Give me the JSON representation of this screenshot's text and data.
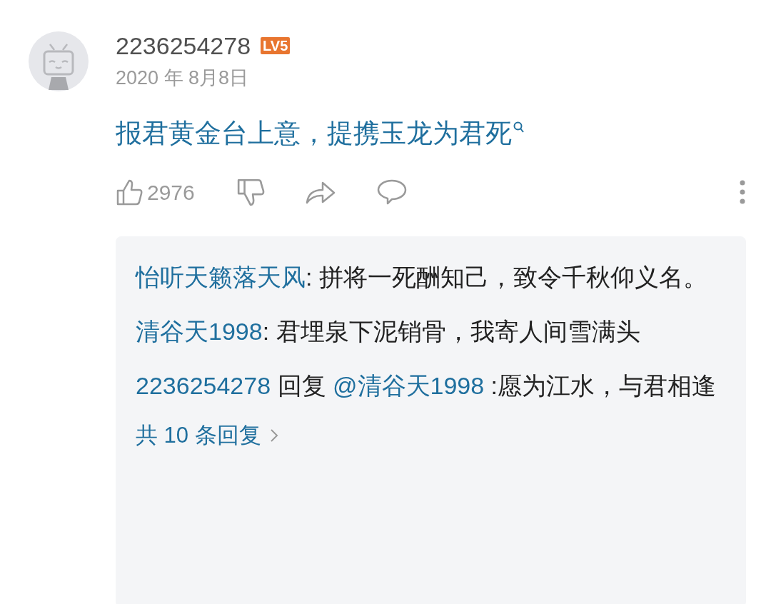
{
  "comment": {
    "username": "2236254278",
    "level_badge": "LV5",
    "date": "2020 年 8月8日",
    "text": "报君黄金台上意，提携玉龙为君死",
    "likes": "2976"
  },
  "replies": [
    {
      "user": "怡听天籁落天风",
      "text": ": 拼将一死酬知己，致令千秋仰义名。"
    },
    {
      "user": "清谷天1998",
      "text": ": 君埋泉下泥销骨，我寄人间雪满头"
    },
    {
      "user": "2236254278",
      "reply_word": "回复",
      "mention": "@清谷天1998",
      "text": " :愿为江水，与君相逢"
    }
  ],
  "more_replies": "共 10 条回复"
}
